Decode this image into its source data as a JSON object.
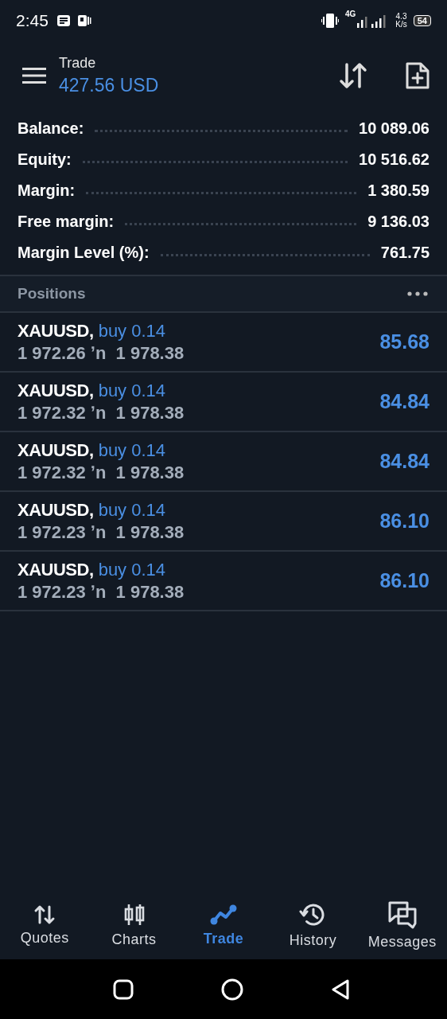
{
  "status_bar": {
    "time": "2:45",
    "network": "4G",
    "speed_value": "4.3",
    "speed_unit": "K/s",
    "battery": "54"
  },
  "header": {
    "title": "Trade",
    "profit": "427.56 USD"
  },
  "summary": [
    {
      "label": "Balance:",
      "value": "10 089.06"
    },
    {
      "label": "Equity:",
      "value": "10 516.62"
    },
    {
      "label": "Margin:",
      "value": "1 380.59"
    },
    {
      "label": "Free margin:",
      "value": "9 136.03"
    },
    {
      "label": "Margin Level (%):",
      "value": "761.75"
    }
  ],
  "positions_header": {
    "title": "Positions"
  },
  "positions": [
    {
      "symbol": "XAUUSD,",
      "order": "buy 0.14",
      "open_price": "1 972.26",
      "separator": "ʼn",
      "current_price": "1 978.38",
      "profit": "85.68"
    },
    {
      "symbol": "XAUUSD,",
      "order": "buy 0.14",
      "open_price": "1 972.32",
      "separator": "ʼn",
      "current_price": "1 978.38",
      "profit": "84.84"
    },
    {
      "symbol": "XAUUSD,",
      "order": "buy 0.14",
      "open_price": "1 972.32",
      "separator": "ʼn",
      "current_price": "1 978.38",
      "profit": "84.84"
    },
    {
      "symbol": "XAUUSD,",
      "order": "buy 0.14",
      "open_price": "1 972.23",
      "separator": "ʼn",
      "current_price": "1 978.38",
      "profit": "86.10"
    },
    {
      "symbol": "XAUUSD,",
      "order": "buy 0.14",
      "open_price": "1 972.23",
      "separator": "ʼn",
      "current_price": "1 978.38",
      "profit": "86.10"
    }
  ],
  "tabs": [
    {
      "kind": "quotes",
      "label": "Quotes",
      "selected": false
    },
    {
      "kind": "charts",
      "label": "Charts",
      "selected": false
    },
    {
      "kind": "trade",
      "label": "Trade",
      "selected": true
    },
    {
      "kind": "history",
      "label": "History",
      "selected": false
    },
    {
      "kind": "messages",
      "label": "Messages",
      "selected": false
    }
  ]
}
